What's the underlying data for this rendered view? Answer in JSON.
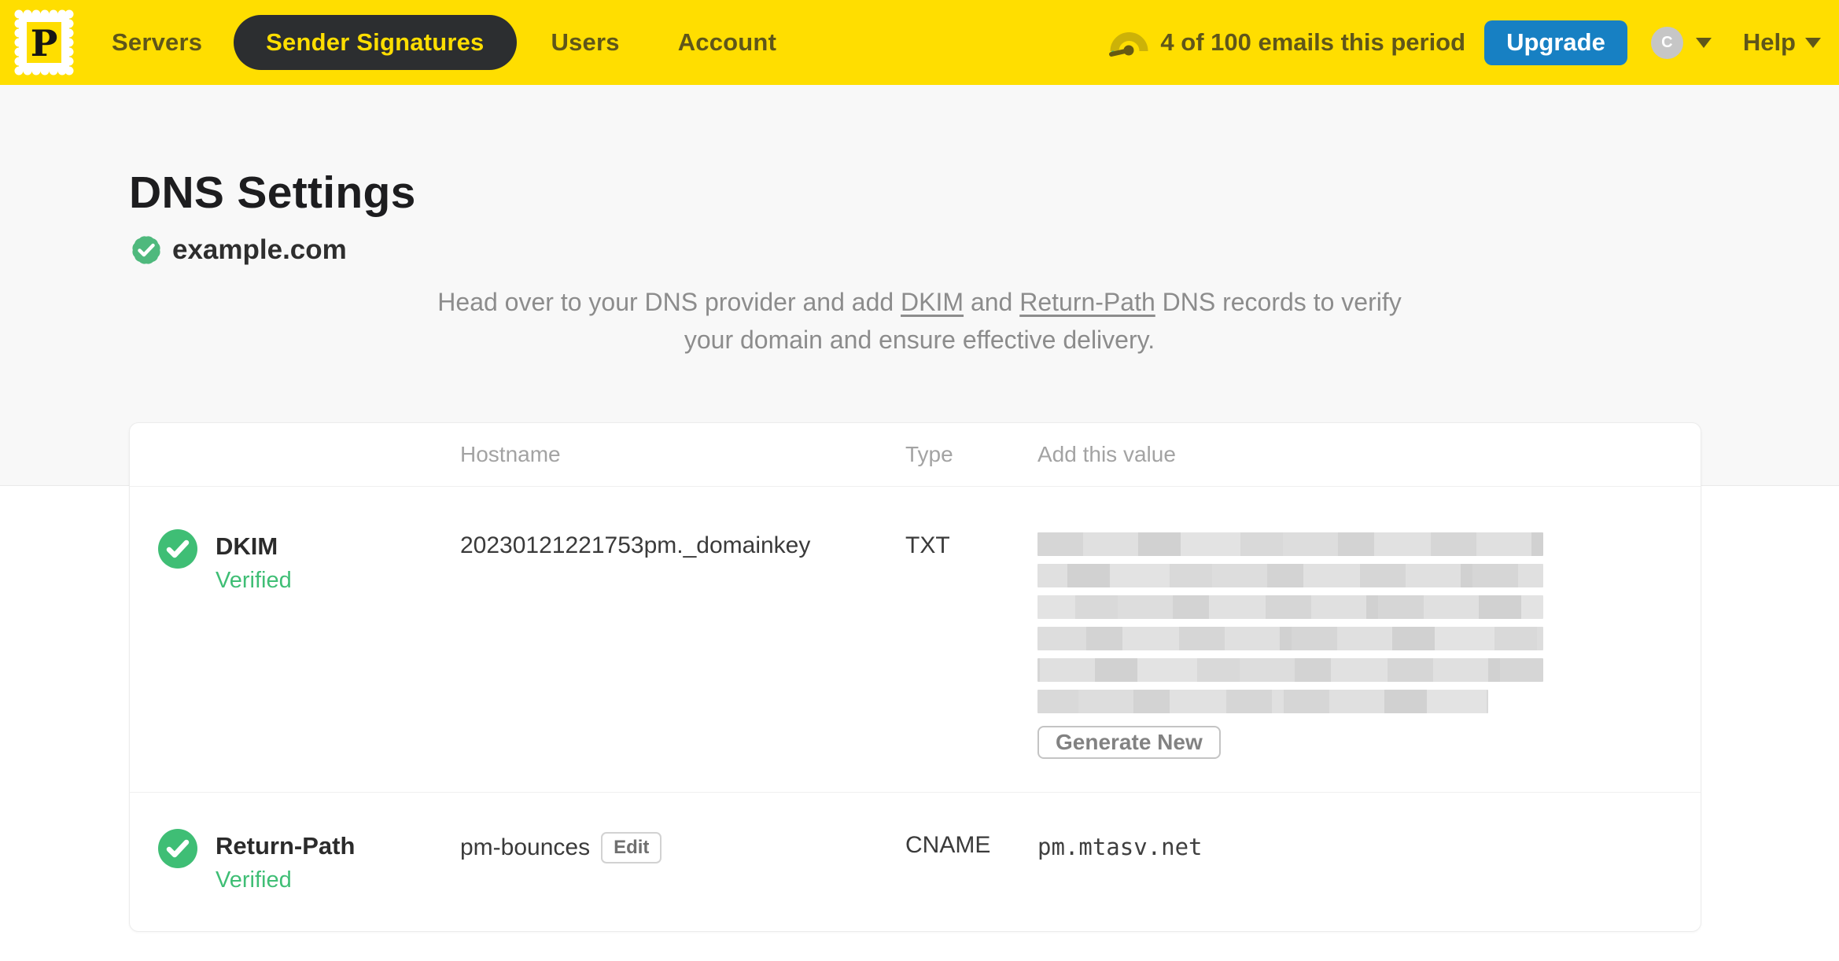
{
  "brand": {
    "logo_letter": "P",
    "yellow": "#FFDE00",
    "blue": "#1780C3",
    "green": "#3FBE75"
  },
  "nav": {
    "items": [
      {
        "label": "Servers",
        "active": false
      },
      {
        "label": "Sender Signatures",
        "active": true
      },
      {
        "label": "Users",
        "active": false
      },
      {
        "label": "Account",
        "active": false
      }
    ],
    "usage_text": "4 of 100 emails this period",
    "upgrade_label": "Upgrade",
    "avatar_initial": "C",
    "help_label": "Help"
  },
  "page": {
    "title": "DNS Settings",
    "domain": "example.com",
    "domain_verified": true,
    "intro": {
      "part1": "Head over to your DNS provider and add ",
      "link_dkim": "DKIM",
      "part2": " and ",
      "link_return_path": "Return-Path",
      "part3": " DNS records to verify your domain and ensure effective delivery."
    }
  },
  "table": {
    "headers": {
      "hostname": "Hostname",
      "type": "Type",
      "value": "Add this value"
    },
    "rows": [
      {
        "name": "DKIM",
        "status": "Verified",
        "hostname": "20230121221753pm._domainkey",
        "type": "TXT",
        "value_redacted": true,
        "action_label": "Generate New"
      },
      {
        "name": "Return-Path",
        "status": "Verified",
        "hostname": "pm-bounces",
        "edit_label": "Edit",
        "type": "CNAME",
        "value": "pm.mtasv.net"
      }
    ]
  }
}
